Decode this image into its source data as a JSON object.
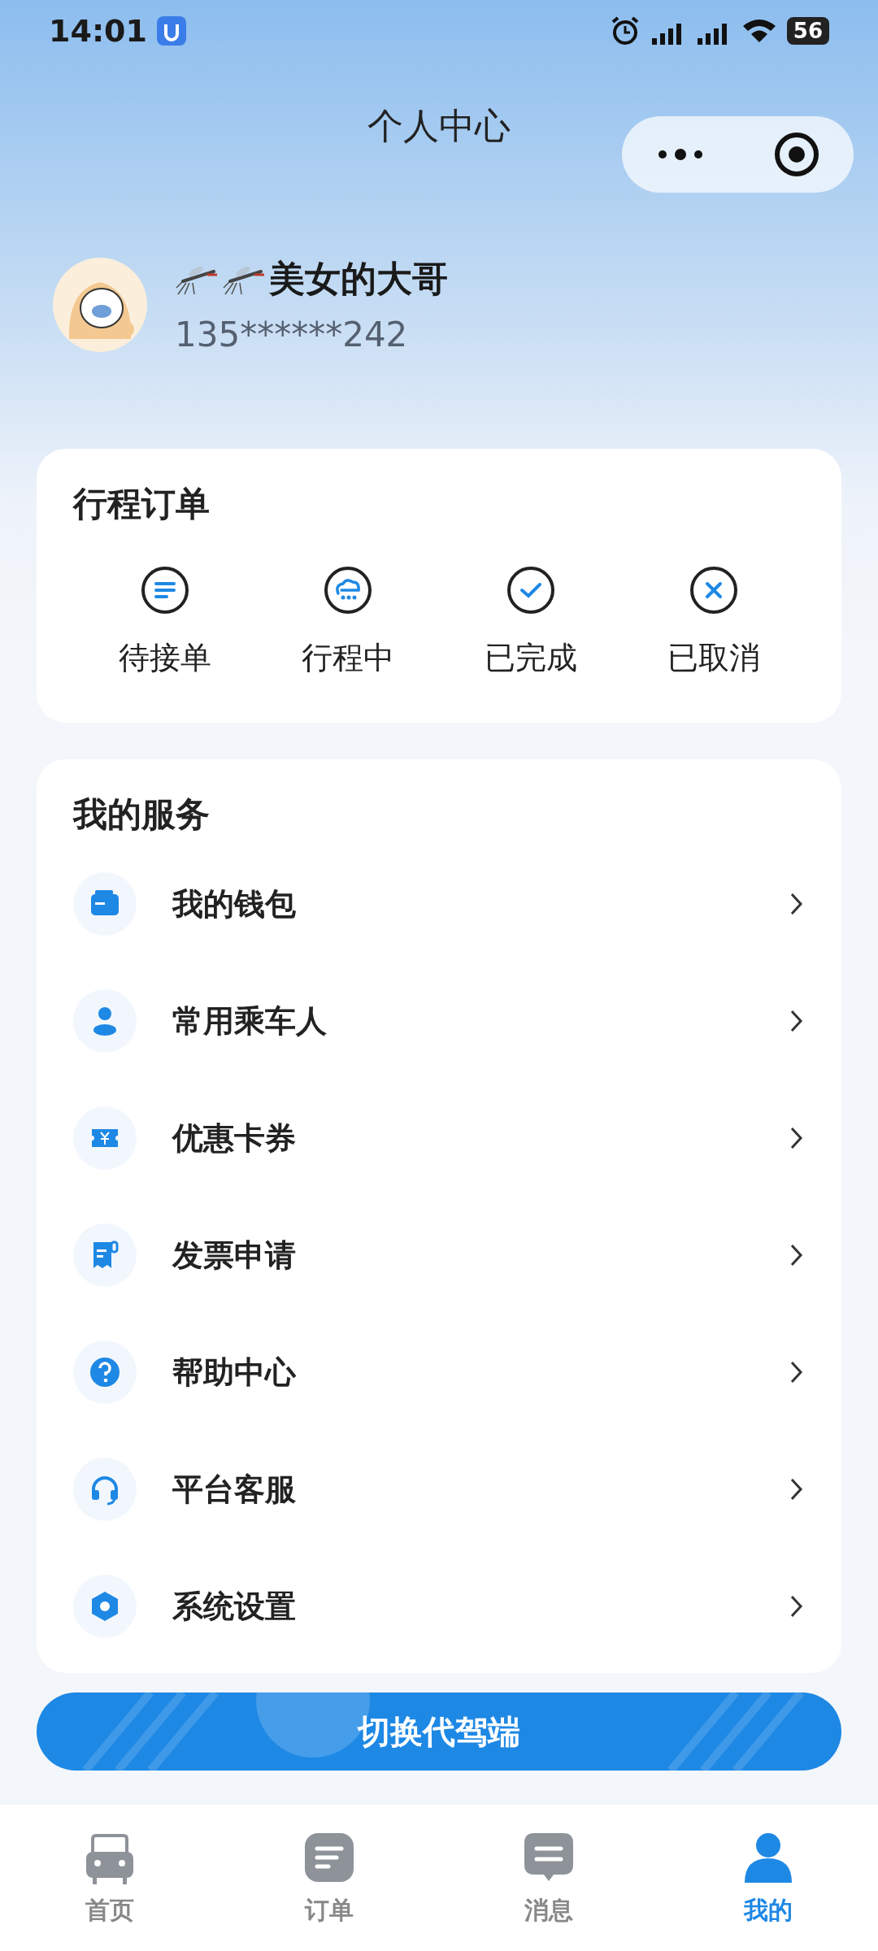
{
  "status_bar": {
    "time": "14:01",
    "battery": "56"
  },
  "nav": {
    "title": "个人中心"
  },
  "profile": {
    "name": "美女的大哥",
    "phone": "135******242"
  },
  "trip_orders": {
    "title": "行程订单",
    "items": [
      {
        "kind": "list",
        "label": "待接单"
      },
      {
        "kind": "cloud",
        "label": "行程中"
      },
      {
        "kind": "check",
        "label": "已完成"
      },
      {
        "kind": "cross",
        "label": "已取消"
      }
    ]
  },
  "services": {
    "title": "我的服务",
    "items": [
      {
        "kind": "wallet",
        "label": "我的钱包"
      },
      {
        "kind": "person",
        "label": "常用乘车人"
      },
      {
        "kind": "coupon",
        "label": "优惠卡券"
      },
      {
        "kind": "receipt",
        "label": "发票申请"
      },
      {
        "kind": "help",
        "label": "帮助中心"
      },
      {
        "kind": "headset",
        "label": "平台客服"
      },
      {
        "kind": "settings",
        "label": "系统设置"
      }
    ]
  },
  "switch_button": {
    "label": "切换代驾端"
  },
  "tab_bar": [
    {
      "kind": "car",
      "label": "首页",
      "selected": false
    },
    {
      "kind": "order",
      "label": "订单",
      "selected": false
    },
    {
      "kind": "message",
      "label": "消息",
      "selected": false
    },
    {
      "kind": "me",
      "label": "我的",
      "selected": true
    }
  ]
}
